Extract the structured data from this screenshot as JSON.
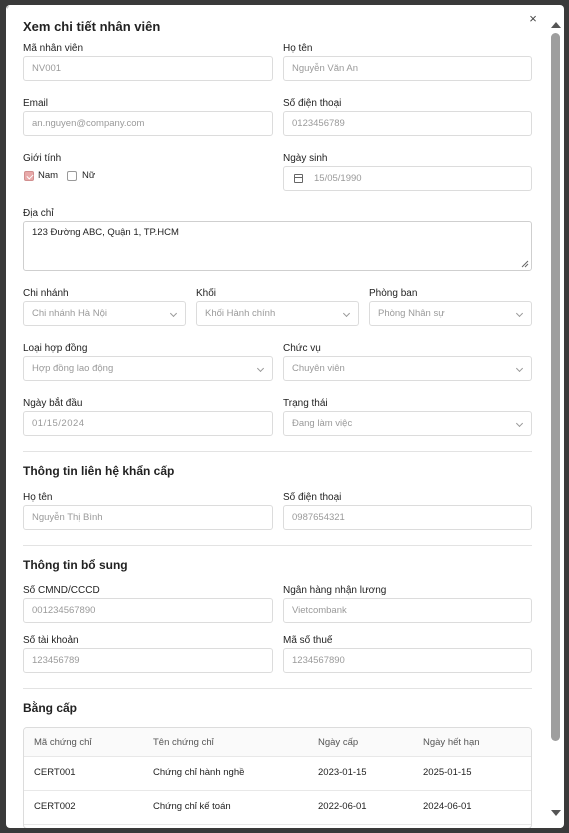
{
  "dialog": {
    "title": "Xem chi tiết nhân viên",
    "close_glyph": "×"
  },
  "fields": {
    "ma_nhan_vien": {
      "label": "Mã nhân viên",
      "value": "NV001"
    },
    "ho_ten": {
      "label": "Họ tên",
      "value": "Nguyễn Văn An"
    },
    "email": {
      "label": "Email",
      "value": "an.nguyen@company.com"
    },
    "so_dien_thoai": {
      "label": "Số điện thoại",
      "value": "0123456789"
    },
    "gioi_tinh": {
      "label": "Giới tính",
      "options": [
        {
          "label": "Nam",
          "checked": true
        },
        {
          "label": "Nữ",
          "checked": false
        }
      ]
    },
    "ngay_sinh": {
      "label": "Ngày sinh",
      "value": "15/05/1990"
    },
    "dia_chi": {
      "label": "Địa chỉ",
      "value": "123 Đường ABC, Quận 1, TP.HCM"
    },
    "chi_nhanh": {
      "label": "Chi nhánh",
      "value": "Chi nhánh Hà Nội"
    },
    "khoi": {
      "label": "Khối",
      "value": "Khối Hành chính"
    },
    "phong_ban": {
      "label": "Phòng ban",
      "value": "Phòng Nhân sự"
    },
    "loai_hop_dong": {
      "label": "Loại hợp đồng",
      "value": "Hợp đồng lao động"
    },
    "chuc_vu": {
      "label": "Chức vụ",
      "value": "Chuyên viên"
    },
    "ngay_bat_dau": {
      "label": "Ngày bắt đầu",
      "value": "01/15/2024"
    },
    "trang_thai": {
      "label": "Trạng thái",
      "value": "Đang làm việc"
    }
  },
  "emergency": {
    "title": "Thông tin liên hệ khẩn cấp",
    "ho_ten": {
      "label": "Họ tên",
      "value": "Nguyễn Thị Bình"
    },
    "so_dien_thoai": {
      "label": "Số điện thoại",
      "value": "0987654321"
    }
  },
  "extra": {
    "title": "Thông tin bổ sung",
    "cmnd": {
      "label": "Số CMND/CCCD",
      "value": "001234567890"
    },
    "ngan_hang": {
      "label": "Ngân hàng nhận lương",
      "value": "Vietcombank"
    },
    "so_tai_khoan": {
      "label": "Số tài khoản",
      "value": "123456789"
    },
    "ma_so_thue": {
      "label": "Mã số thuế",
      "value": "1234567890"
    }
  },
  "certificates": {
    "title": "Bằng cấp",
    "columns": [
      "Mã chứng chỉ",
      "Tên chứng chỉ",
      "Ngày cấp",
      "Ngày hết hạn"
    ],
    "rows": [
      [
        "CERT001",
        "Chứng chỉ hành nghề",
        "2023-01-15",
        "2025-01-15"
      ],
      [
        "CERT002",
        "Chứng chỉ kế toán",
        "2022-06-01",
        "2024-06-01"
      ]
    ]
  }
}
